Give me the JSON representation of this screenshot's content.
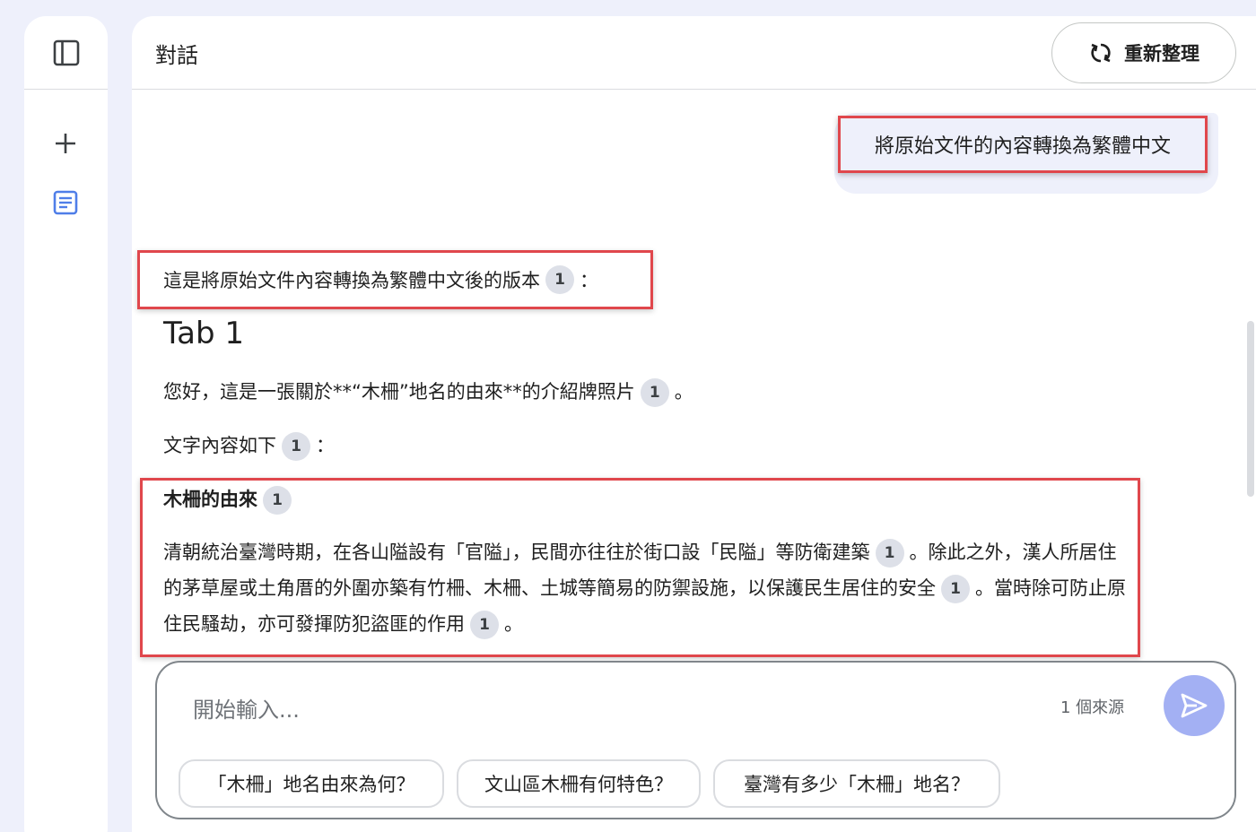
{
  "header": {
    "title": "對話",
    "refresh_label": "重新整理"
  },
  "conversation": {
    "user_message": "將原始文件的內容轉換為繁體中文",
    "intro": "這是將原始文件內容轉換為繁體中文後的版本",
    "intro_suffix": "：",
    "tab_heading": "Tab 1",
    "para1": "您好，這是一張關於**“木柵”地名的由來**的介紹牌照片",
    "para1_suffix": "。",
    "para2": "文字內容如下",
    "para2_suffix": "：",
    "section_title": "木柵的由來",
    "section_body_1": "清朝統治臺灣時期，在各山隘設有「官隘」，民間亦往往於街口設「民隘」等防衛建築",
    "section_body_2": "。除此之外，漢人所居住的茅草屋或土角厝的外圍亦築有竹柵、木柵、土城等簡易的防禦設施，以保護民生居住的安全",
    "section_body_3": "。當時除可防止原住民騷劫，亦可發揮防犯盜匪的作用",
    "section_body_4": "。",
    "citation": "1"
  },
  "input": {
    "placeholder": "開始輸入...",
    "source_count": "1 個來源"
  },
  "suggestions": [
    "「木柵」地名由來為何？",
    "文山區木柵有何特色？",
    "臺灣有多少「木柵」地名？"
  ],
  "icons": {
    "rail_toggle": "sidebar-toggle-icon",
    "add": "plus-icon",
    "note": "note-icon",
    "refresh": "refresh-icon",
    "send": "send-icon"
  },
  "colors": {
    "accent": "#a3b0f3",
    "highlight_border": "#e0474c",
    "background": "#eef0fb"
  }
}
